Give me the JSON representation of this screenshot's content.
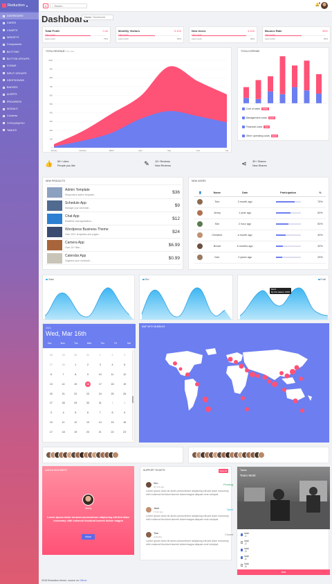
{
  "app": {
    "brand": "Reduction"
  },
  "sidebar": {
    "items": [
      {
        "label": "DASHBOARD",
        "active": true
      },
      {
        "label": "CARDS"
      },
      {
        "label": "CHARTS"
      },
      {
        "label": "WIDGETS"
      },
      {
        "label": "Components"
      },
      {
        "label": "BUTTONS"
      },
      {
        "label": "BUTTON GROUPS"
      },
      {
        "label": "FORMS"
      },
      {
        "label": "INPUT GROUPS"
      },
      {
        "label": "DROPDOWNS"
      },
      {
        "label": "BADGES"
      },
      {
        "label": "ALERTS"
      },
      {
        "label": "PROGRESS"
      },
      {
        "label": "MODALS"
      },
      {
        "label": "Contents"
      },
      {
        "label": "TYPOGRAPHY"
      },
      {
        "label": "TABLES"
      }
    ]
  },
  "topbar": {
    "search_placeholder": "Search..."
  },
  "page": {
    "title": "Dashboard",
    "breadcrumb": [
      "Home",
      "Dashboard"
    ]
  },
  "stats": [
    {
      "title": "Total Profit",
      "value": "0.4k",
      "sub": "This month",
      "last": "Last month",
      "pct": "75%",
      "fill": 0.75
    },
    {
      "title": "Monthly Visitors",
      "value": "5,400",
      "sub": "This month",
      "last": "Last month",
      "pct": "60%",
      "fill": 0.6
    },
    {
      "title": "New Users",
      "value": "3,400",
      "sub": "This month",
      "last": "Last month",
      "pct": "90%",
      "fill": 0.9
    },
    {
      "title": "Bounce Rate",
      "value": "38%",
      "sub": "This month",
      "last": "Last month",
      "pct": "60%",
      "fill": 0.6
    }
  ],
  "revenue": {
    "title": "TOTAL REVENUE",
    "subtitle": "This Year",
    "chart_data": {
      "type": "area",
      "categories": [
        "January",
        "February",
        "March",
        "April",
        "May",
        "June",
        "July"
      ],
      "ylim": [
        0,
        1000
      ],
      "yticks": [
        0,
        100,
        200,
        300,
        400,
        500,
        600,
        700,
        800,
        900,
        1000
      ],
      "series": [
        {
          "color": "#ff5277",
          "values": [
            40,
            190,
            390,
            590,
            930,
            760,
            610
          ]
        },
        {
          "color": "#6c7ef0",
          "values": [
            15,
            80,
            170,
            330,
            420,
            360,
            290
          ]
        }
      ]
    }
  },
  "expense": {
    "title": "TOTAL EXPENSE",
    "chart_data": {
      "type": "bar",
      "series": [
        {
          "color": "#6c7ef0",
          "values": [
            10,
            8,
            22,
            17,
            30,
            24,
            18
          ]
        },
        {
          "color": "#ff5277",
          "values": [
            20,
            35,
            28,
            70,
            40,
            55,
            36
          ]
        }
      ]
    },
    "items": [
      {
        "label": "Cost of sales",
        "badge": "$3000",
        "icon_color": "#6c7ef0"
      },
      {
        "label": "Management costs",
        "badge": "$1200",
        "icon_color": "#6c7ef0"
      },
      {
        "label": "Financial costs",
        "badge": "$400",
        "icon_color": "#6c7ef0"
      },
      {
        "label": "Other operating costs",
        "badge": "$2400",
        "icon_color": "#6c7ef0"
      }
    ]
  },
  "social": [
    {
      "icon": "thumbs-up-icon",
      "line1": "50+ Likes",
      "line2": "People you like"
    },
    {
      "icon": "edit-icon",
      "line1": "10+ Reviews",
      "line2": "New Reviews"
    },
    {
      "icon": "share-icon",
      "line1": "30+ Shares",
      "line2": "New Shares"
    }
  ],
  "new_products": {
    "title": "NEW PRODUCTS",
    "items": [
      {
        "name": "Admin Template",
        "desc": "Responsive admin template...",
        "price": "$36",
        "color": "#8ca0c0"
      },
      {
        "name": "Schedule App",
        "desc": "Manage your schedule...",
        "price": "$9",
        "color": "#506a90"
      },
      {
        "name": "Chat App",
        "desc": "Realtime chat application...",
        "price": "$12",
        "color": "#2d7fd1"
      },
      {
        "name": "Wordpress Business Theme",
        "desc": "Over 100+ templates and pages...",
        "price": "$24",
        "color": "#3a4a70"
      },
      {
        "name": "Camera App",
        "desc": "Over 10+ filter...",
        "price": "$6.99",
        "color": "#a8643a"
      },
      {
        "name": "Calendar App",
        "desc": "Organize your schedule...",
        "price": "$0.99",
        "color": "#c8c4b8"
      }
    ]
  },
  "new_users": {
    "title": "NEW USERS",
    "columns": [
      "Name",
      "Date",
      "Participation",
      "%"
    ],
    "rows": [
      {
        "name": "Tom",
        "date": "3 month ago",
        "pct": "75%",
        "fill": 0.75
      },
      {
        "name": "Jenny",
        "date": "1 year ago",
        "pct": "60%",
        "fill": 0.6
      },
      {
        "name": "Sim",
        "date": "2 hour ago",
        "pct": "50%",
        "fill": 0.5
      },
      {
        "name": "Christine",
        "date": "a month ago",
        "pct": "40%",
        "fill": 0.4
      },
      {
        "name": "Bread",
        "date": "6 months ago",
        "pct": "30%",
        "fill": 0.3
      },
      {
        "name": "Dan",
        "date": "2 years ago",
        "pct": "25%",
        "fill": 0.25
      }
    ]
  },
  "sparks": [
    {
      "label": "Sales"
    },
    {
      "label": "Rev"
    },
    {
      "label": "Profit",
      "tooltip_title": "March",
      "tooltip_value": "My First dataset: 16000"
    }
  ],
  "calendar": {
    "year": "2021",
    "date": "Wed, Mar 16th",
    "weekdays": [
      "Sun",
      "Mon",
      "Tue",
      "Wed",
      "Thu",
      "Fri",
      "Sat"
    ],
    "weeks": [
      [
        "28",
        "29",
        "30",
        "31",
        "1",
        "2",
        "3"
      ],
      [
        "27",
        "28",
        "1",
        "2",
        "3",
        "4",
        "5"
      ],
      [
        "6",
        "7",
        "8",
        "9",
        "10",
        "11",
        "12"
      ],
      [
        "13",
        "14",
        "15",
        "16",
        "17",
        "18",
        "19"
      ],
      [
        "20",
        "21",
        "22",
        "23",
        "24",
        "25",
        "26"
      ],
      [
        "27",
        "28",
        "29",
        "30",
        "31",
        "1",
        "2"
      ],
      [
        "3",
        "4",
        "5",
        "6",
        "7",
        "8",
        "9"
      ],
      [
        "10",
        "11",
        "12",
        "13",
        "14",
        "15",
        "16"
      ],
      [
        "17",
        "18",
        "19",
        "20",
        "21",
        "22",
        "23"
      ]
    ],
    "selected": "16"
  },
  "map": {
    "title": "MAP WITH BUBBLES"
  },
  "announcement": {
    "title": "ANNOUNCEMENT",
    "name": "Jenny",
    "text": "Lorem ipsum dolor sit amet,consectetuer adipiscing elit.Sed diam nonummy nibh euismod tincidunt laoreet dolore magna",
    "button": "show"
  },
  "tickets": {
    "title": "SUPPORT TICKETS",
    "view_all": "View All",
    "items": [
      {
        "name": "Sim",
        "date": "30 mins ago",
        "status": "Pending",
        "status_color": "#3aa86b",
        "body": "Lorem ipsum dolor sit amet,consectetuer adipiscing elit,sed diam nonummy nibh euismod tincidunt laoreet doloremagna aliquam erat volutpat."
      },
      {
        "name": "Jane",
        "date": "1 hour ago",
        "status": "Open",
        "status_color": "#2aa8e0",
        "body": "Lorem ipsum dolor sit amet,consectetuer adipiscing elit,sed diam nonummy nibh euismod tincidunt laoreet doloremagna aliquam erat volutpat."
      },
      {
        "name": "Tom",
        "date": "yesterday",
        "status": "Closed",
        "status_color": "#888",
        "body": "Lorem ipsum dolor sit amet,consectetuer adipiscing elit,sed diam nonummy nibh euismod tincidunt laoreet doloremagna aliquam erat volutpat."
      }
    ]
  },
  "tasks": {
    "title": "Tasks",
    "subtitle": "Team Work",
    "items": [
      {
        "label": "task -1",
        "checked": true
      },
      {
        "label": "task -2",
        "checked": false
      },
      {
        "label": "task -3",
        "checked": true
      },
      {
        "label": "task -4",
        "checked": true
      },
      {
        "label": "task -5",
        "checked": false
      }
    ],
    "add_label": "Add"
  },
  "footer": {
    "text": "2018 Reduction theme, source on",
    "link": "Github"
  }
}
